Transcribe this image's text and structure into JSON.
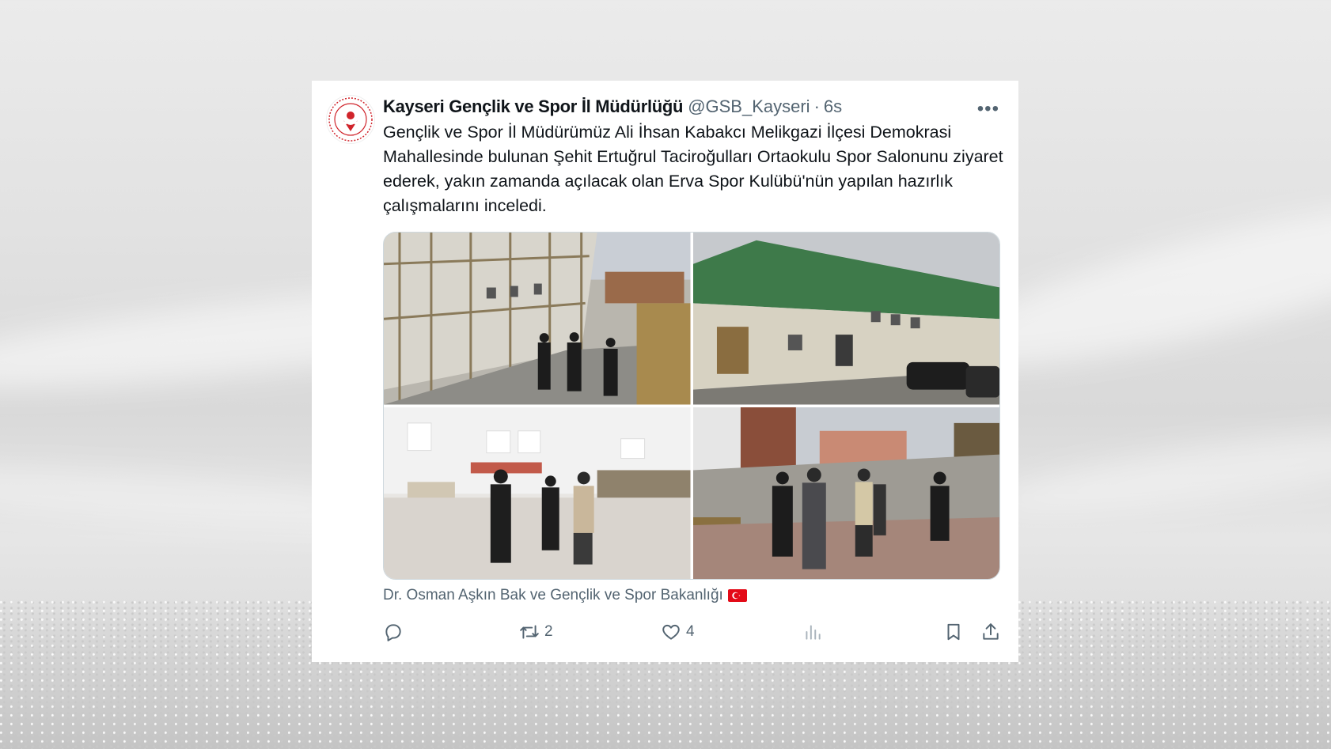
{
  "tweet": {
    "display_name": "Kayseri Gençlik ve Spor İl Müdürlüğü",
    "handle": "@GSB_Kayseri",
    "separator": "·",
    "time": "6s",
    "more_icon": "more-horizontal-icon",
    "text": "Gençlik ve Spor İl Müdürümüz Ali İhsan Kabakcı Melikgazi İlçesi Demokrasi Mahallesinde bulunan Şehit Ertuğrul Taciroğulları Ortaokulu Spor Salonunu ziyaret ederek, yakın zamanda açılacak olan Erva Spor Kulübü'nün yapılan hazırlık çalışmalarını inceledi.",
    "tags": "Dr. Osman Aşkın Bak ve Gençlik ve Spor Bakanlığı",
    "tags_flag_icon": "turkey-flag-icon",
    "photos": 4,
    "actions": {
      "reply": {
        "icon": "reply-icon",
        "count": ""
      },
      "retweet": {
        "icon": "retweet-icon",
        "count": "2"
      },
      "like": {
        "icon": "heart-icon",
        "count": "4"
      },
      "views": {
        "icon": "analytics-icon",
        "count": ""
      },
      "bookmark": {
        "icon": "bookmark-icon"
      },
      "share": {
        "icon": "share-icon"
      }
    }
  },
  "colors": {
    "text_primary": "#0f1419",
    "text_secondary": "#536471",
    "ministry_red": "#d0242b"
  }
}
